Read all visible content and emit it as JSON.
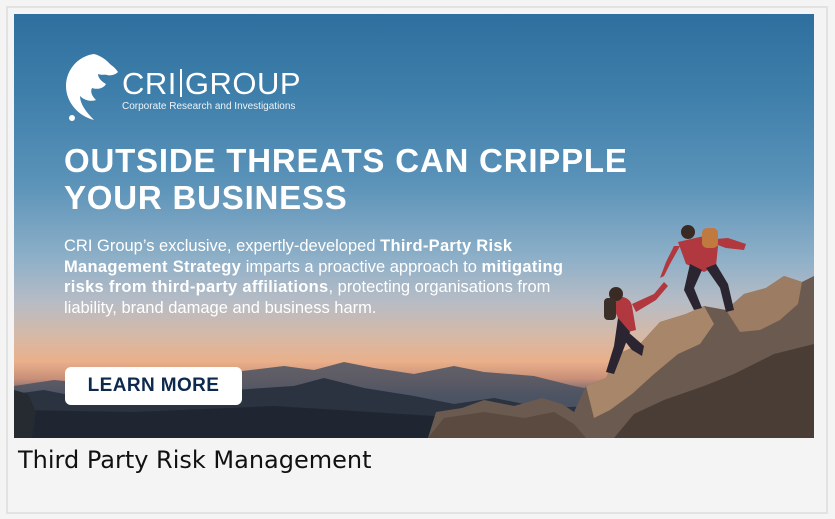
{
  "banner": {
    "logo": {
      "brand_left": "CRI",
      "brand_right": "GROUP",
      "tagline": "Corporate Research and Investigations"
    },
    "headline_line1": "OUTSIDE THREATS CAN CRIPPLE",
    "headline_line2": "YOUR BUSINESS",
    "body": {
      "part1": "CRI Group’s exclusive, expertly-developed ",
      "bold1": "Third-Party Risk Management Strategy",
      "part2": " imparts a proactive approach to ",
      "bold2": "mitigating risks from third-party affiliations",
      "part3": ", protecting organisations from liability, brand damage and business harm."
    },
    "cta_label": "LEARN MORE"
  },
  "caption": "Third Party Risk Management",
  "colors": {
    "sky_top": "#2f6f9f",
    "horizon": "#e9b08a",
    "cta_text": "#0d2a4e",
    "page_bg": "#f4f4f4"
  }
}
